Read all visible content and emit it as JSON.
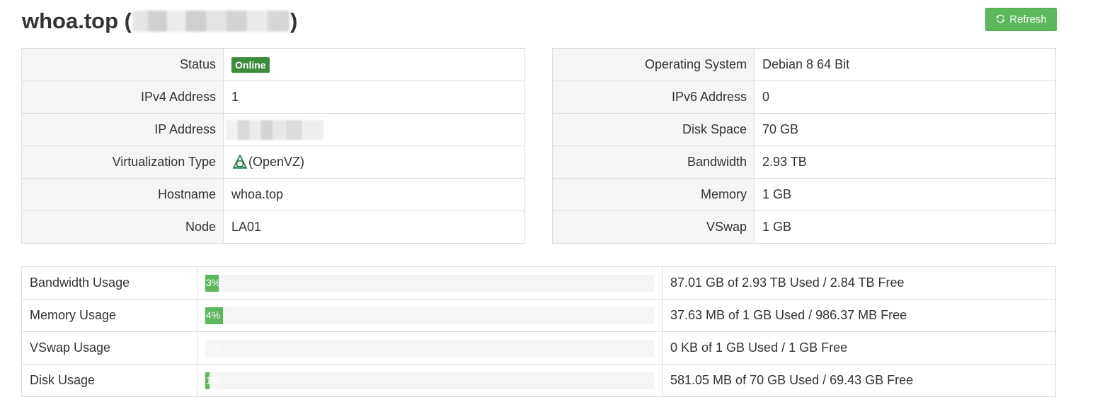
{
  "header": {
    "title": "whoa.top",
    "open_paren": "(",
    "close_paren": ")",
    "refresh_label": "Refresh"
  },
  "left_info": {
    "rows": [
      {
        "label": "Status",
        "value": "Online"
      },
      {
        "label": "IPv4 Address",
        "value": "1"
      },
      {
        "label": "IP Address",
        "value": ""
      },
      {
        "label": "Virtualization Type",
        "value": "(OpenVZ)"
      },
      {
        "label": "Hostname",
        "value": "whoa.top"
      },
      {
        "label": "Node",
        "value": "LA01"
      }
    ]
  },
  "right_info": {
    "rows": [
      {
        "label": "Operating System",
        "value": "Debian 8 64 Bit"
      },
      {
        "label": "IPv6 Address",
        "value": "0"
      },
      {
        "label": "Disk Space",
        "value": "70 GB"
      },
      {
        "label": "Bandwidth",
        "value": "2.93 TB"
      },
      {
        "label": "Memory",
        "value": "1 GB"
      },
      {
        "label": "VSwap",
        "value": "1 GB"
      }
    ]
  },
  "usage": {
    "rows": [
      {
        "label": "Bandwidth Usage",
        "percent": 3,
        "percent_label": "3%",
        "detail": "87.01 GB of 2.93 TB Used / 2.84 TB Free"
      },
      {
        "label": "Memory Usage",
        "percent": 4,
        "percent_label": "4%",
        "detail": "37.63 MB of 1 GB Used / 986.37 MB Free"
      },
      {
        "label": "VSwap Usage",
        "percent": 0,
        "percent_label": "0%",
        "detail": "0 KB of 1 GB Used / 1 GB Free"
      },
      {
        "label": "Disk Usage",
        "percent": 1,
        "percent_label": "1%",
        "detail": "581.05 MB of 70 GB Used / 69.43 GB Free"
      }
    ]
  },
  "colors": {
    "success": "#5cb85c",
    "badge": "#3c8c3c",
    "label_bg": "#f5f5f5",
    "border": "#dddddd"
  },
  "icons": {
    "refresh": "refresh-icon",
    "virtualization": "openvz-icon"
  }
}
